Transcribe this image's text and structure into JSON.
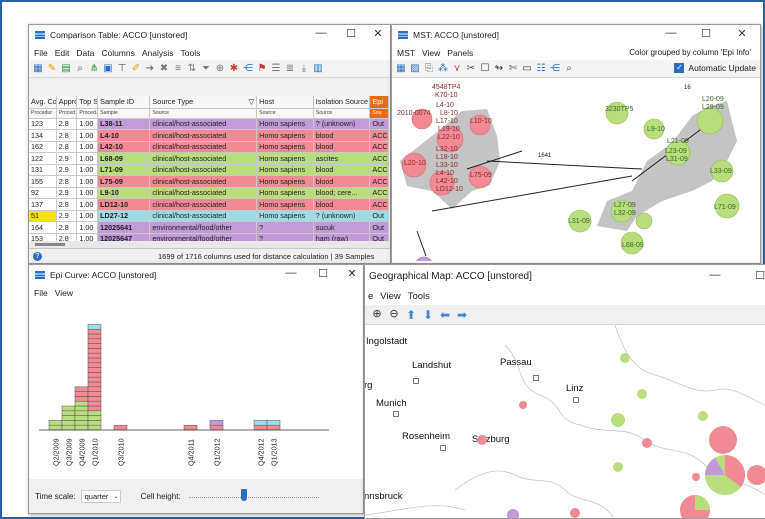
{
  "colors": {
    "pink": "#f08a95",
    "purple": "#c09ad9",
    "green": "#b9dd7c",
    "cyan": "#9fdbe7",
    "orange": "#e86b1c",
    "highlight": "#f5e10f",
    "accent_blue": "#2b6fc2"
  },
  "table_win": {
    "title": "Comparison Table: ACCO [unstored]",
    "menus": [
      "File",
      "Edit",
      "Data",
      "Columns",
      "Analysis",
      "Tools"
    ],
    "headers": [
      "Avg. Co",
      "Appro",
      "Top Sc",
      "Sample ID",
      "Source Type",
      "Host",
      "Isolation Source",
      "Epi"
    ],
    "subheaders": [
      "Procedur",
      "Proced.",
      "Proced.",
      "Sample",
      "Source",
      "Source",
      "Source",
      "Sou"
    ],
    "rows": [
      {
        "c": [
          "123",
          "2.8",
          "1.00",
          "L38-11",
          "clinical/host-associated",
          "Homo sapiens",
          "? (unknown)",
          "Out"
        ],
        "color": "purple",
        "sel": false
      },
      {
        "c": [
          "134",
          "2.8",
          "1.00",
          "L4-10",
          "clinical/host-associated",
          "Homo sapiens",
          "blood",
          "ACC"
        ],
        "color": "pink",
        "sel": false
      },
      {
        "c": [
          "162",
          "2.8",
          "1.00",
          "L42-10",
          "clinical/host-associated",
          "Homo sapiens",
          "blood",
          "ACC"
        ],
        "color": "pink",
        "sel": false
      },
      {
        "c": [
          "122",
          "2.9",
          "1.00",
          "L68-09",
          "clinical/host-associated",
          "Homo sapiens",
          "ascites",
          "ACC"
        ],
        "color": "green",
        "sel": false
      },
      {
        "c": [
          "131",
          "2.9",
          "1.00",
          "L71-09",
          "clinical/host-associated",
          "Homo sapiens",
          "blood",
          "ACC"
        ],
        "color": "green",
        "sel": false
      },
      {
        "c": [
          "155",
          "2.8",
          "1.00",
          "L75-09",
          "clinical/host-associated",
          "Homo sapiens",
          "blood",
          "ACC"
        ],
        "color": "pink",
        "sel": false
      },
      {
        "c": [
          "92",
          "2.9",
          "1.00",
          "L9-10",
          "clinical/host-associated",
          "Homo sapiens",
          "blood; cere...",
          "ACC"
        ],
        "color": "green",
        "sel": false
      },
      {
        "c": [
          "137",
          "2.8",
          "1.00",
          "LD12-10",
          "clinical/host-associated",
          "Homo sapiens",
          "blood",
          "ACC"
        ],
        "color": "pink",
        "sel": false
      },
      {
        "c": [
          "51",
          "2.9",
          "1.00",
          "LD27-12",
          "clinical/host-associated",
          "Homo sapiens",
          "? (unknown)",
          "Out"
        ],
        "color": "cyan",
        "sel": true
      },
      {
        "c": [
          "164",
          "2.8",
          "1.00",
          "12025641",
          "environmental/food/other",
          "?",
          "sucuk",
          "Out"
        ],
        "color": "purple",
        "sel": false
      },
      {
        "c": [
          "153",
          "2.8",
          "1.00",
          "12025647",
          "environmental/food/other",
          "?",
          "ham (raw)",
          "Out"
        ],
        "color": "purple",
        "sel": false
      }
    ],
    "status": "1699 of 1716 columns used for distance calculation  |  39 Samples"
  },
  "mst_win": {
    "title": "MST: ACCO [unstored]",
    "menus": [
      "MST",
      "View",
      "Panels"
    ],
    "color_note": "Color grouped by column 'Epi Info'",
    "auto_update": "Automatic Update",
    "edge_labels": [
      "1641",
      "16"
    ],
    "left_labels": [
      "4548TP4",
      "K70-10",
      "2010-0074",
      "L4-10",
      "L8-10",
      "L10-10",
      "L17-10",
      "L19-10",
      "L20-10",
      "L22-10",
      "L75-09",
      "L32-10",
      "L18-10",
      "L33-10",
      "L4-10",
      "L42-10",
      "LD12-10"
    ],
    "right_labels": [
      "3230TP5",
      "L20-09",
      "L29-09",
      "L9-10",
      "L21-09",
      "L23-09",
      "L31-09",
      "L33-09",
      "L71-09",
      "L27-09",
      "L32-09",
      "L31-09",
      "L68-09"
    ]
  },
  "epi_win": {
    "title": "Epi Curve: ACCO [unstored]",
    "menus": [
      "File",
      "View"
    ],
    "x_labels": [
      "Q2/2009",
      "Q3/2009",
      "Q4/2009",
      "Q1/2010",
      "Q3/2010",
      "Q4/2011",
      "Q1/2012",
      "Q4/2012",
      "Q1/2013"
    ],
    "time_scale_label": "Time scale:",
    "time_scale_value": "quarter",
    "cell_height_label": "Cell height:"
  },
  "chart_data": {
    "type": "bar",
    "categories": [
      "Q2/2009",
      "Q3/2009",
      "Q4/2009",
      "Q1/2010",
      "Q3/2010",
      "Q4/2011",
      "Q1/2012",
      "Q4/2012",
      "Q1/2013"
    ],
    "series": [
      {
        "color": "green",
        "values": [
          2,
          5,
          6,
          4,
          0,
          0,
          0,
          0,
          0
        ]
      },
      {
        "color": "pink",
        "values": [
          0,
          0,
          3,
          17,
          1,
          1,
          1,
          1,
          1
        ]
      },
      {
        "color": "purple",
        "values": [
          0,
          0,
          0,
          0,
          0,
          0,
          1,
          0,
          0
        ]
      },
      {
        "color": "cyan",
        "values": [
          0,
          0,
          0,
          1,
          0,
          0,
          0,
          1,
          1
        ]
      }
    ]
  },
  "map_win": {
    "title": "Geographical Map: ACCO [unstored]",
    "menus": [
      "e",
      "View",
      "Tools"
    ],
    "cities": [
      "Ingolstadt",
      "Landshut",
      "Passau",
      "Linz",
      "rg",
      "Munich",
      "Rosenheim",
      "Salzburg",
      "nnsbruck"
    ]
  }
}
